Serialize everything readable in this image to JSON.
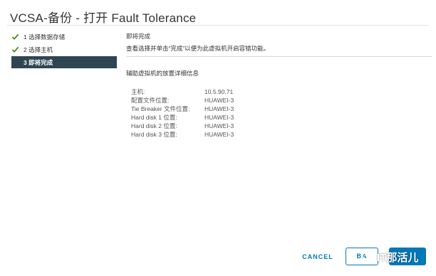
{
  "dialog": {
    "title": "VCSA-备份 - 打开 Fault Tolerance"
  },
  "steps": [
    {
      "label": "1 选择数据存储",
      "state": "completed",
      "icon": "check-icon"
    },
    {
      "label": "2 选择主机",
      "state": "completed",
      "icon": "check-icon"
    },
    {
      "label": "3 即将完成",
      "state": "active"
    }
  ],
  "content": {
    "heading": "即将完成",
    "description": "查看选择并单击“完成”以便为此虚拟机开启容错功能。",
    "subheading": "辅助虚拟机的放置详细信息",
    "details": [
      {
        "label": "主机:",
        "value": "10.5.90.71"
      },
      {
        "label": "配置文件位置:",
        "value": "HUAWEI-3"
      },
      {
        "label": "Tie Breaker 文件位置:",
        "value": "HUAWEI-3"
      },
      {
        "label": "Hard disk 1 位置:",
        "value": "HUAWEI-3"
      },
      {
        "label": "Hard disk 2 位置:",
        "value": "HUAWEI-3"
      },
      {
        "label": "Hard disk 3 位置:",
        "value": "HUAWEI-3"
      }
    ]
  },
  "footer": {
    "cancel_label": "CANCEL",
    "back_label": "BA",
    "watermark_text": "IT那活儿"
  },
  "colors": {
    "accent": "#0079b8",
    "check_green": "#3c8500",
    "active_step_bg": "#2f4552"
  }
}
